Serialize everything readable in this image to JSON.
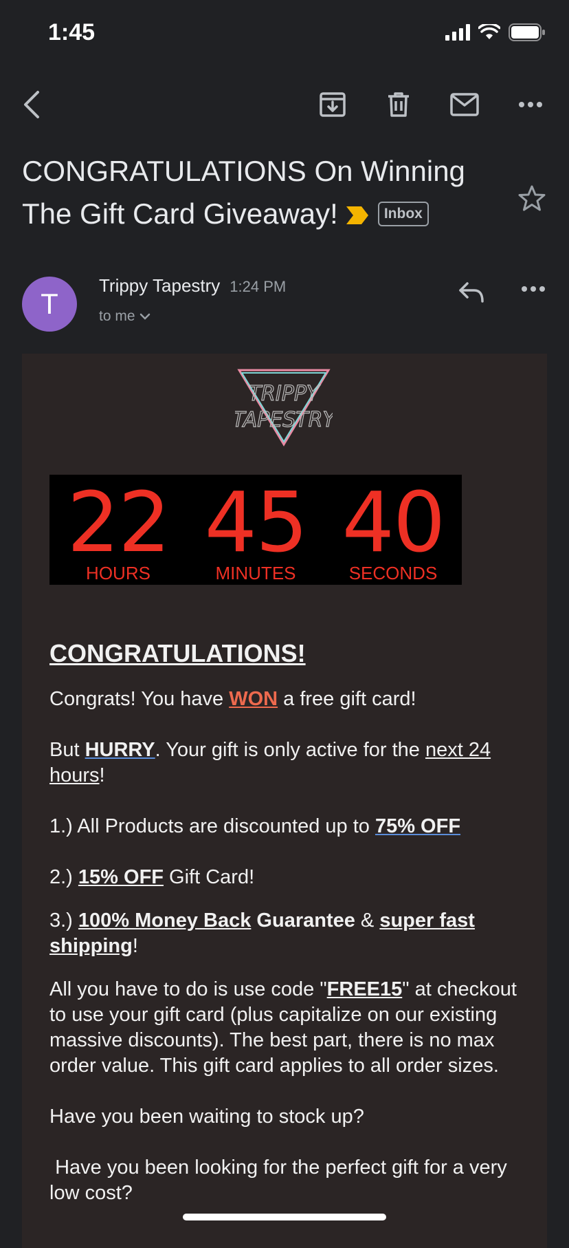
{
  "status": {
    "time": "1:45"
  },
  "toolbar": {
    "back": "back-icon",
    "archive": "archive-icon",
    "delete": "trash-icon",
    "mark_unread": "mail-icon",
    "more": "more-icon"
  },
  "subject": {
    "text": "CONGRATULATIONS On Winning The Gift Card Giveaway!",
    "label_chip": "Inbox",
    "important_color": "#f4b400"
  },
  "sender": {
    "avatar_letter": "T",
    "avatar_color": "#8e64c9",
    "name": "Trippy Tapestry",
    "time": "1:24 PM",
    "recipient": "to me"
  },
  "logo": {
    "line1": "TRIPPY",
    "line2": "TAPESTRY"
  },
  "countdown": {
    "hours": "22",
    "hours_label": "HOURS",
    "minutes": "45",
    "minutes_label": "MINUTES",
    "seconds": "40",
    "seconds_label": "SECONDS",
    "color": "#ee3024"
  },
  "body": {
    "heading": "CONGRATULATIONS!",
    "p1_a": "Congrats! You have ",
    "p1_won": "WON",
    "p1_b": " a free gift card!",
    "p2_a": "But ",
    "p2_hurry": "HURRY",
    "p2_b": ". Your gift is only active for the ",
    "p2_next": "next 24 hours",
    "p2_c": "!",
    "item1_a": "1.) All Products are discounted up to ",
    "item1_b": "75% OFF",
    "item2_a": "2.) ",
    "item2_b": "15% OFF",
    "item2_c": " Gift Card!",
    "item3_a": "3.) ",
    "item3_b": "100% Money Back",
    "item3_c": " Guarantee",
    "item3_d": " & ",
    "item3_e": "super fast shipping",
    "item3_f": "!",
    "code_a": "All you have to do is use code \"",
    "code_b": "FREE15",
    "code_c": "\" at checkout to use your gift card (plus capitalize on our existing massive discounts). The best part, there is no max order value. This gift card applies to all order sizes.",
    "q1": "Have you been waiting to stock up?",
    "q2": " Have you been looking for the perfect gift for a very low cost?"
  }
}
